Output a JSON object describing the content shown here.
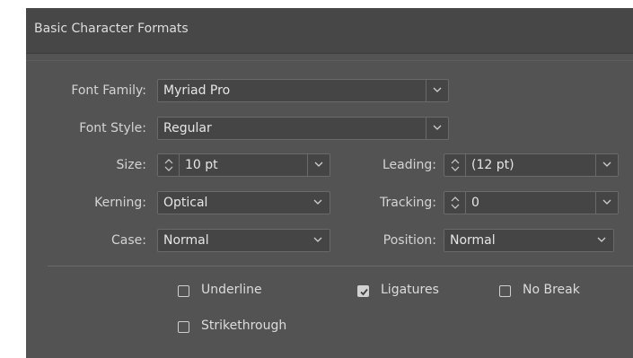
{
  "panel": {
    "title": "Basic Character Formats"
  },
  "font_family": {
    "label": "Font Family:",
    "value": "Myriad Pro"
  },
  "font_style": {
    "label": "Font Style:",
    "value": "Regular"
  },
  "size": {
    "label": "Size:",
    "value": "10 pt"
  },
  "leading": {
    "label": "Leading:",
    "value": "(12 pt)"
  },
  "kerning": {
    "label": "Kerning:",
    "value": "Optical"
  },
  "tracking": {
    "label": "Tracking:",
    "value": "0"
  },
  "case": {
    "label": "Case:",
    "value": "Normal"
  },
  "position": {
    "label": "Position:",
    "value": "Normal"
  },
  "options": {
    "underline": {
      "label": "Underline",
      "checked": false
    },
    "ligatures": {
      "label": "Ligatures",
      "checked": true
    },
    "no_break": {
      "label": "No Break",
      "checked": false
    },
    "strikethrough": {
      "label": "Strikethrough",
      "checked": false
    }
  },
  "icons": {
    "dropdown": "chevron-down-icon",
    "stepper": "stepper-arrows-icon",
    "check": "checkmark-icon"
  },
  "colors": {
    "panel_bg": "#535353",
    "header_bg": "#474747",
    "field_bg": "#454545",
    "field_border": "#6a6a6a",
    "text": "#d6d6d6"
  }
}
